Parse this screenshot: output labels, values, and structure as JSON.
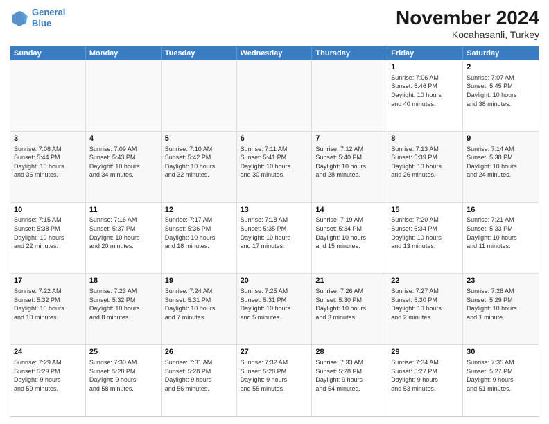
{
  "header": {
    "logo_line1": "General",
    "logo_line2": "Blue",
    "month": "November 2024",
    "location": "Kocahasanli, Turkey"
  },
  "weekdays": [
    "Sunday",
    "Monday",
    "Tuesday",
    "Wednesday",
    "Thursday",
    "Friday",
    "Saturday"
  ],
  "weeks": [
    [
      {
        "day": "",
        "info": ""
      },
      {
        "day": "",
        "info": ""
      },
      {
        "day": "",
        "info": ""
      },
      {
        "day": "",
        "info": ""
      },
      {
        "day": "",
        "info": ""
      },
      {
        "day": "1",
        "info": "Sunrise: 7:06 AM\nSunset: 5:46 PM\nDaylight: 10 hours\nand 40 minutes."
      },
      {
        "day": "2",
        "info": "Sunrise: 7:07 AM\nSunset: 5:45 PM\nDaylight: 10 hours\nand 38 minutes."
      }
    ],
    [
      {
        "day": "3",
        "info": "Sunrise: 7:08 AM\nSunset: 5:44 PM\nDaylight: 10 hours\nand 36 minutes."
      },
      {
        "day": "4",
        "info": "Sunrise: 7:09 AM\nSunset: 5:43 PM\nDaylight: 10 hours\nand 34 minutes."
      },
      {
        "day": "5",
        "info": "Sunrise: 7:10 AM\nSunset: 5:42 PM\nDaylight: 10 hours\nand 32 minutes."
      },
      {
        "day": "6",
        "info": "Sunrise: 7:11 AM\nSunset: 5:41 PM\nDaylight: 10 hours\nand 30 minutes."
      },
      {
        "day": "7",
        "info": "Sunrise: 7:12 AM\nSunset: 5:40 PM\nDaylight: 10 hours\nand 28 minutes."
      },
      {
        "day": "8",
        "info": "Sunrise: 7:13 AM\nSunset: 5:39 PM\nDaylight: 10 hours\nand 26 minutes."
      },
      {
        "day": "9",
        "info": "Sunrise: 7:14 AM\nSunset: 5:38 PM\nDaylight: 10 hours\nand 24 minutes."
      }
    ],
    [
      {
        "day": "10",
        "info": "Sunrise: 7:15 AM\nSunset: 5:38 PM\nDaylight: 10 hours\nand 22 minutes."
      },
      {
        "day": "11",
        "info": "Sunrise: 7:16 AM\nSunset: 5:37 PM\nDaylight: 10 hours\nand 20 minutes."
      },
      {
        "day": "12",
        "info": "Sunrise: 7:17 AM\nSunset: 5:36 PM\nDaylight: 10 hours\nand 18 minutes."
      },
      {
        "day": "13",
        "info": "Sunrise: 7:18 AM\nSunset: 5:35 PM\nDaylight: 10 hours\nand 17 minutes."
      },
      {
        "day": "14",
        "info": "Sunrise: 7:19 AM\nSunset: 5:34 PM\nDaylight: 10 hours\nand 15 minutes."
      },
      {
        "day": "15",
        "info": "Sunrise: 7:20 AM\nSunset: 5:34 PM\nDaylight: 10 hours\nand 13 minutes."
      },
      {
        "day": "16",
        "info": "Sunrise: 7:21 AM\nSunset: 5:33 PM\nDaylight: 10 hours\nand 11 minutes."
      }
    ],
    [
      {
        "day": "17",
        "info": "Sunrise: 7:22 AM\nSunset: 5:32 PM\nDaylight: 10 hours\nand 10 minutes."
      },
      {
        "day": "18",
        "info": "Sunrise: 7:23 AM\nSunset: 5:32 PM\nDaylight: 10 hours\nand 8 minutes."
      },
      {
        "day": "19",
        "info": "Sunrise: 7:24 AM\nSunset: 5:31 PM\nDaylight: 10 hours\nand 7 minutes."
      },
      {
        "day": "20",
        "info": "Sunrise: 7:25 AM\nSunset: 5:31 PM\nDaylight: 10 hours\nand 5 minutes."
      },
      {
        "day": "21",
        "info": "Sunrise: 7:26 AM\nSunset: 5:30 PM\nDaylight: 10 hours\nand 3 minutes."
      },
      {
        "day": "22",
        "info": "Sunrise: 7:27 AM\nSunset: 5:30 PM\nDaylight: 10 hours\nand 2 minutes."
      },
      {
        "day": "23",
        "info": "Sunrise: 7:28 AM\nSunset: 5:29 PM\nDaylight: 10 hours\nand 1 minute."
      }
    ],
    [
      {
        "day": "24",
        "info": "Sunrise: 7:29 AM\nSunset: 5:29 PM\nDaylight: 9 hours\nand 59 minutes."
      },
      {
        "day": "25",
        "info": "Sunrise: 7:30 AM\nSunset: 5:28 PM\nDaylight: 9 hours\nand 58 minutes."
      },
      {
        "day": "26",
        "info": "Sunrise: 7:31 AM\nSunset: 5:28 PM\nDaylight: 9 hours\nand 56 minutes."
      },
      {
        "day": "27",
        "info": "Sunrise: 7:32 AM\nSunset: 5:28 PM\nDaylight: 9 hours\nand 55 minutes."
      },
      {
        "day": "28",
        "info": "Sunrise: 7:33 AM\nSunset: 5:28 PM\nDaylight: 9 hours\nand 54 minutes."
      },
      {
        "day": "29",
        "info": "Sunrise: 7:34 AM\nSunset: 5:27 PM\nDaylight: 9 hours\nand 53 minutes."
      },
      {
        "day": "30",
        "info": "Sunrise: 7:35 AM\nSunset: 5:27 PM\nDaylight: 9 hours\nand 51 minutes."
      }
    ]
  ]
}
